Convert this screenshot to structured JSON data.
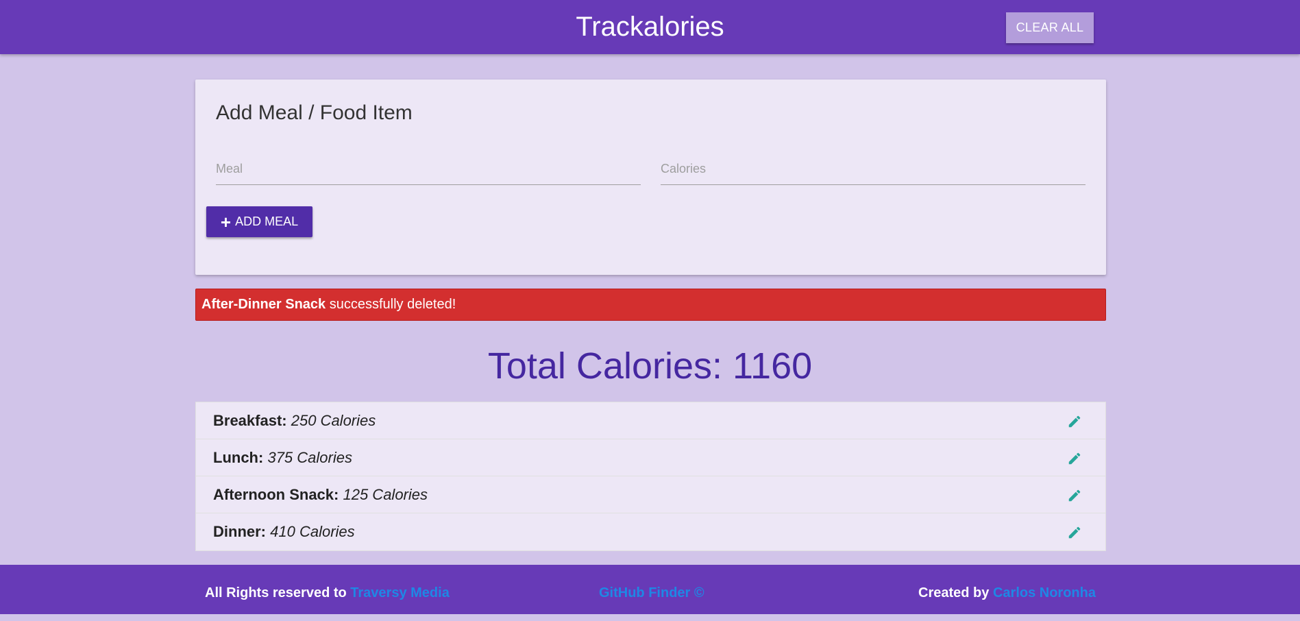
{
  "navbar": {
    "brand": "Trackalories",
    "clear_all_label": "CLEAR ALL"
  },
  "form": {
    "title": "Add Meal / Food Item",
    "meal_placeholder": "Meal",
    "meal_value": "",
    "calories_placeholder": "Calories",
    "calories_value": "",
    "add_meal_label": "ADD MEAL",
    "add_icon": "plus-icon"
  },
  "alert": {
    "item_name": "After-Dinner Snack",
    "message": " successfully deleted!",
    "color": "#d32f2f"
  },
  "total": {
    "label": "Total Calories: ",
    "value": "1160"
  },
  "items": [
    {
      "name": "Breakfast:",
      "calories": "250 Calories",
      "icon": "pencil-icon"
    },
    {
      "name": "Lunch:",
      "calories": "375 Calories",
      "icon": "pencil-icon"
    },
    {
      "name": "Afternoon Snack:",
      "calories": "125 Calories",
      "icon": "pencil-icon"
    },
    {
      "name": "Dinner:",
      "calories": "410 Calories",
      "icon": "pencil-icon"
    }
  ],
  "footer": {
    "left_text": "All Rights reserved to ",
    "left_link": "Traversy Media",
    "mid_link": "GitHub Finder ©",
    "right_text": "Created by ",
    "right_link": "Carlos Noronha"
  },
  "colors": {
    "primary": "#673ab7",
    "background": "#d1c4e9",
    "card": "#ede7f6",
    "accent_button": "#512da8",
    "total_text": "#4527a0",
    "edit_icon": "#26a69a",
    "link": "#1e88e5"
  }
}
